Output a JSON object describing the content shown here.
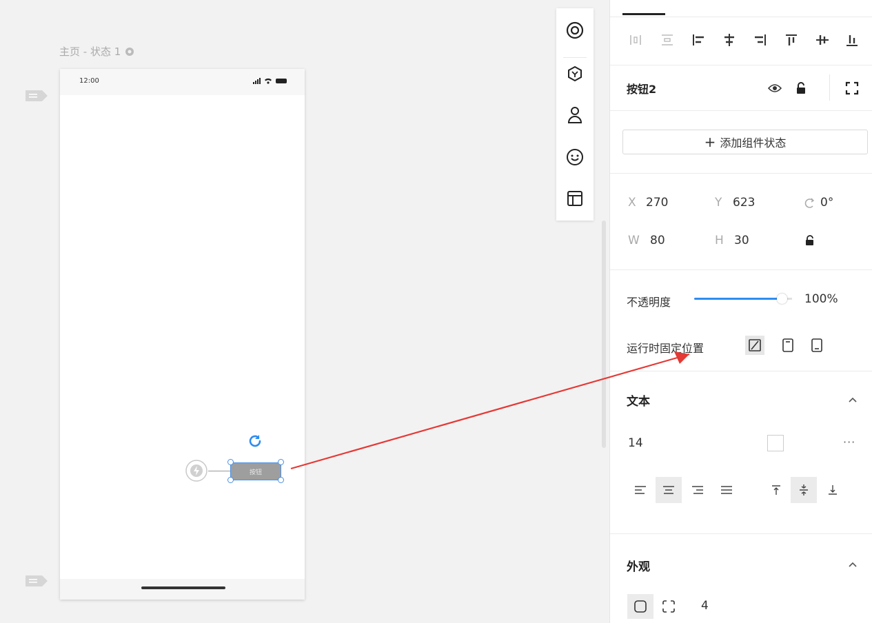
{
  "canvas": {
    "page_label": "主页 - 状态 1",
    "phone": {
      "status_time": "12:00",
      "button_text": "按钮"
    }
  },
  "floating_toolbar": {
    "items": [
      "target-icon",
      "component-icon",
      "user-icon",
      "emoji-icon",
      "layout-icon"
    ]
  },
  "panel": {
    "align_tools": [
      "distribute-horizontal-icon",
      "distribute-vertical-icon",
      "align-left-icon",
      "align-center-horizontal-icon",
      "align-right-icon",
      "align-top-icon",
      "align-middle-icon",
      "align-bottom-icon"
    ],
    "object_title": "按钮2",
    "add_state_label": "添加组件状态",
    "geometry": {
      "x_label": "X",
      "x_value": "270",
      "y_label": "Y",
      "y_value": "623",
      "rotation_value": "0°",
      "w_label": "W",
      "w_value": "80",
      "h_label": "H",
      "h_value": "30"
    },
    "opacity_label": "不透明度",
    "opacity_value": "100%",
    "opacity_fraction": 1.0,
    "fixed_position_label": "运行时固定位置",
    "text_section": {
      "title": "文本",
      "font_size": "14"
    },
    "appearance_section": {
      "title": "外观",
      "radius_value": "4"
    }
  },
  "colors": {
    "accent": "#2d8cf0",
    "selection": "#4a90e2",
    "annotation_arrow": "#e53935"
  }
}
